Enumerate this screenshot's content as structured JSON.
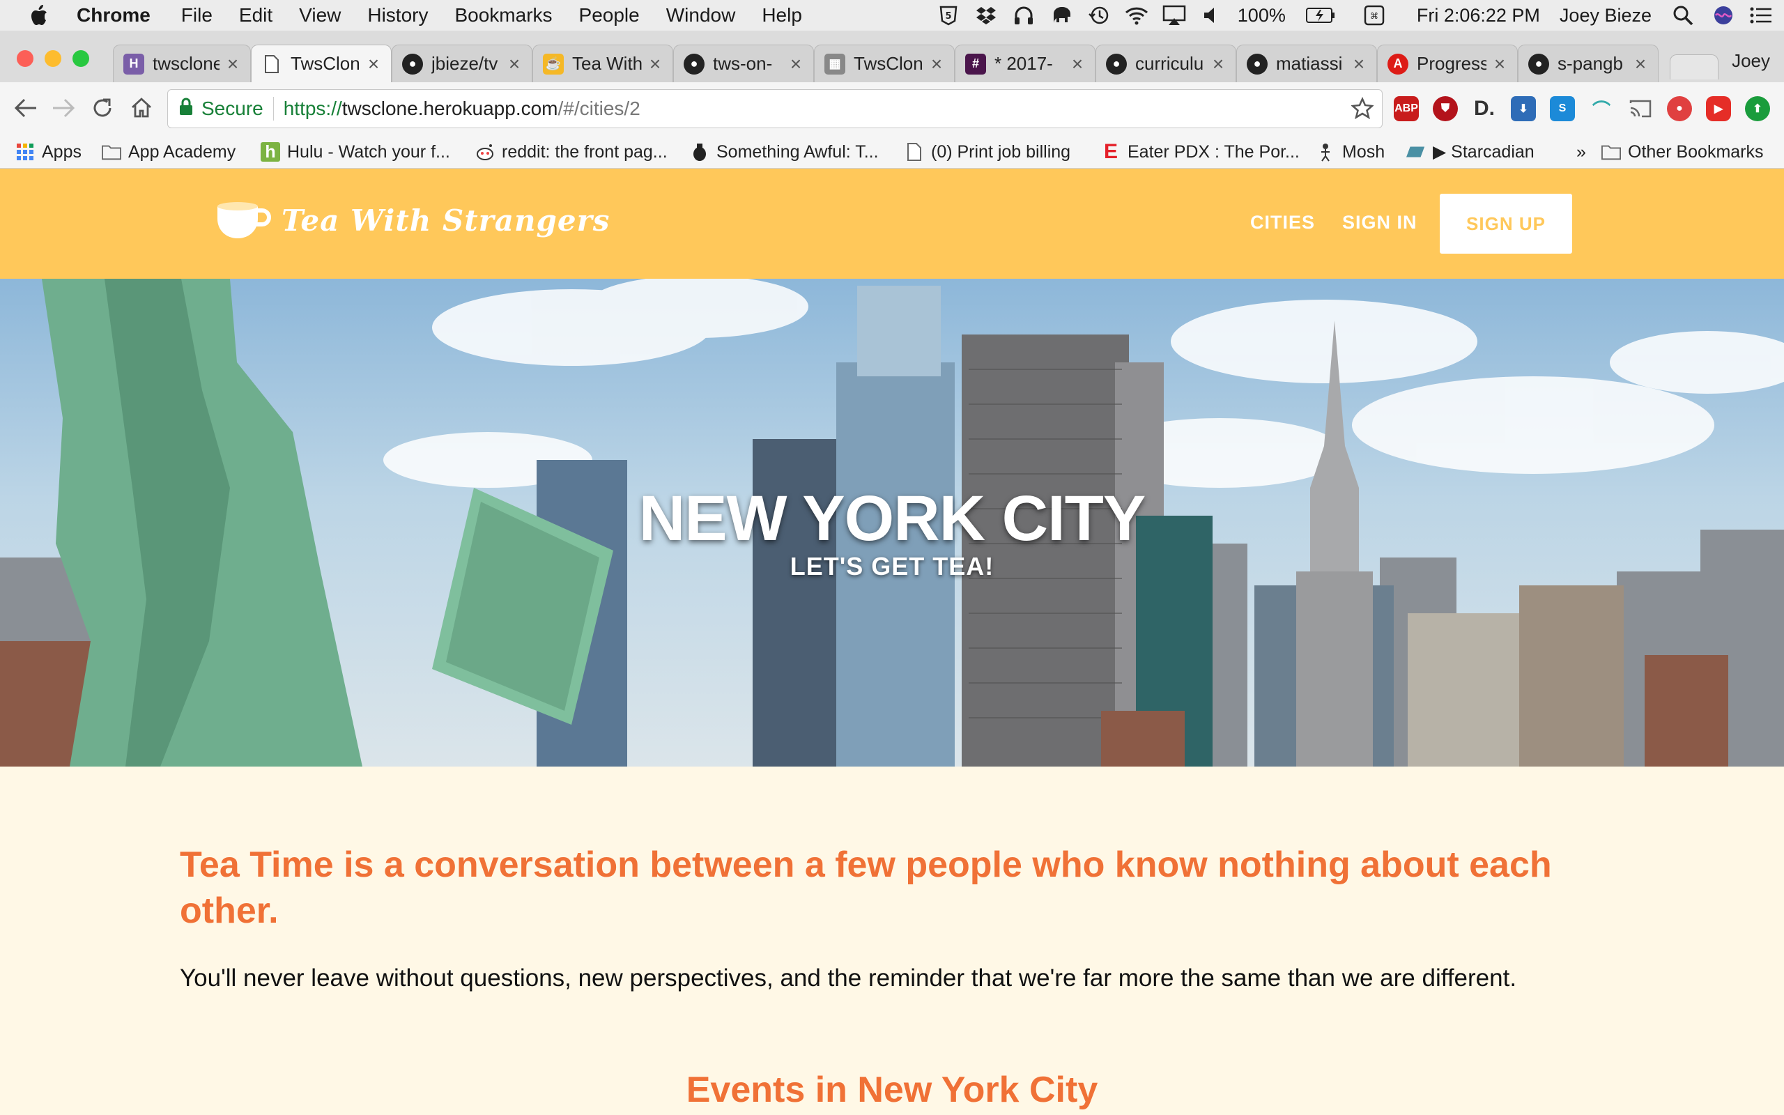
{
  "menubar": {
    "app": "Chrome",
    "items": [
      "File",
      "Edit",
      "View",
      "History",
      "Bookmarks",
      "People",
      "Window",
      "Help"
    ],
    "battery": "100%",
    "clock": "Fri 2:06:22 PM",
    "user": "Joey Bieze"
  },
  "tabs": [
    {
      "title": "twsclone",
      "favicon": "heroku-icon",
      "color": "#7a5ea8"
    },
    {
      "title": "TwsClon",
      "favicon": "page-icon",
      "color": "#ffffff"
    },
    {
      "title": "jbieze/tv",
      "favicon": "github-icon",
      "color": "#222222"
    },
    {
      "title": "Tea With",
      "favicon": "tea-icon",
      "color": "#f5b826"
    },
    {
      "title": "tws-on-",
      "favicon": "github-icon",
      "color": "#222222"
    },
    {
      "title": "TwsClon",
      "favicon": "site-icon",
      "color": "#888888"
    },
    {
      "title": "* 2017-",
      "favicon": "slack-icon",
      "color": "#4a154b"
    },
    {
      "title": "curriculu",
      "favicon": "github-icon",
      "color": "#222222"
    },
    {
      "title": "matiassi",
      "favicon": "github-icon",
      "color": "#222222"
    },
    {
      "title": "Progress",
      "favicon": "angular-icon",
      "color": "#dd1b16"
    },
    {
      "title": "s-pangb",
      "favicon": "github-icon",
      "color": "#222222"
    }
  ],
  "profile": "Joey",
  "omnibox": {
    "secure_label": "Secure",
    "scheme": "https://",
    "host": "twsclone.herokuapp.com",
    "path": "/#/cities/2"
  },
  "bookmarks": [
    {
      "label": "Apps",
      "icon": "apps-grid-icon"
    },
    {
      "label": "App Academy",
      "icon": "folder-icon"
    },
    {
      "label": "Hulu - Watch your f...",
      "icon": "hulu-icon"
    },
    {
      "label": "reddit: the front pag...",
      "icon": "reddit-icon"
    },
    {
      "label": "Something Awful: T...",
      "icon": "grenade-icon"
    },
    {
      "label": "(0) Print job billing",
      "icon": "page-icon"
    },
    {
      "label": "Eater PDX : The Por...",
      "icon": "eater-icon"
    },
    {
      "label": "Mosh",
      "icon": "mosh-icon"
    },
    {
      "label": "▶ Starcadian",
      "icon": "starcadian-icon"
    },
    {
      "label": "»",
      "icon": ""
    },
    {
      "label": "Other Bookmarks",
      "icon": "folder-icon"
    }
  ],
  "site": {
    "brand": "Tea With Strangers",
    "nav": {
      "cities": "CITIES",
      "signin": "SIGN IN",
      "signup": "SIGN UP"
    },
    "colors": {
      "header": "#ffc85a",
      "accent": "#f07136",
      "background": "#fff8e6"
    }
  },
  "hero": {
    "title": "NEW YORK CITY",
    "subtitle": "LET'S GET TEA!"
  },
  "content": {
    "headline": "Tea Time is a conversation between a few people who know nothing about each other.",
    "tagline": "You'll never leave without questions, new perspectives, and the reminder that we're far more the same than we are different.",
    "events_heading": "Events in New York City"
  }
}
